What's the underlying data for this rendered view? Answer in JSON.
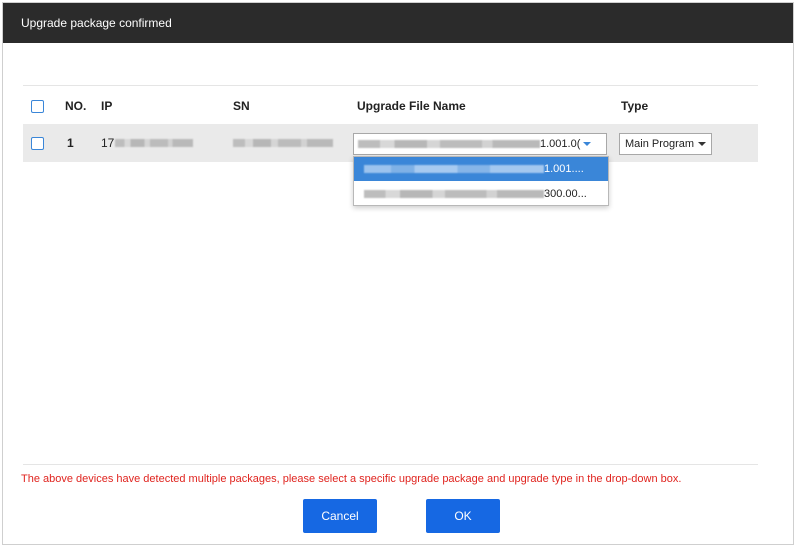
{
  "dialog": {
    "title": "Upgrade package confirmed"
  },
  "table": {
    "columns": [
      "NO.",
      "IP",
      "SN",
      "Upgrade File Name",
      "Type"
    ],
    "rows": [
      {
        "no": "1",
        "ip_prefix": "17",
        "file_suffix": "1.001.0(",
        "type": "Main Program"
      }
    ]
  },
  "dropdown": {
    "options": [
      {
        "suffix": "1.001....",
        "selected": true
      },
      {
        "suffix": "300.00...",
        "selected": false
      }
    ]
  },
  "footer": {
    "warning": "The above devices have detected multiple packages, please select a specific upgrade package and upgrade type in the drop-down box.",
    "cancel_label": "Cancel",
    "ok_label": "OK"
  },
  "colors": {
    "titlebar": "#2b2b2b",
    "accent": "#1668e3",
    "warning": "#e0241f"
  }
}
